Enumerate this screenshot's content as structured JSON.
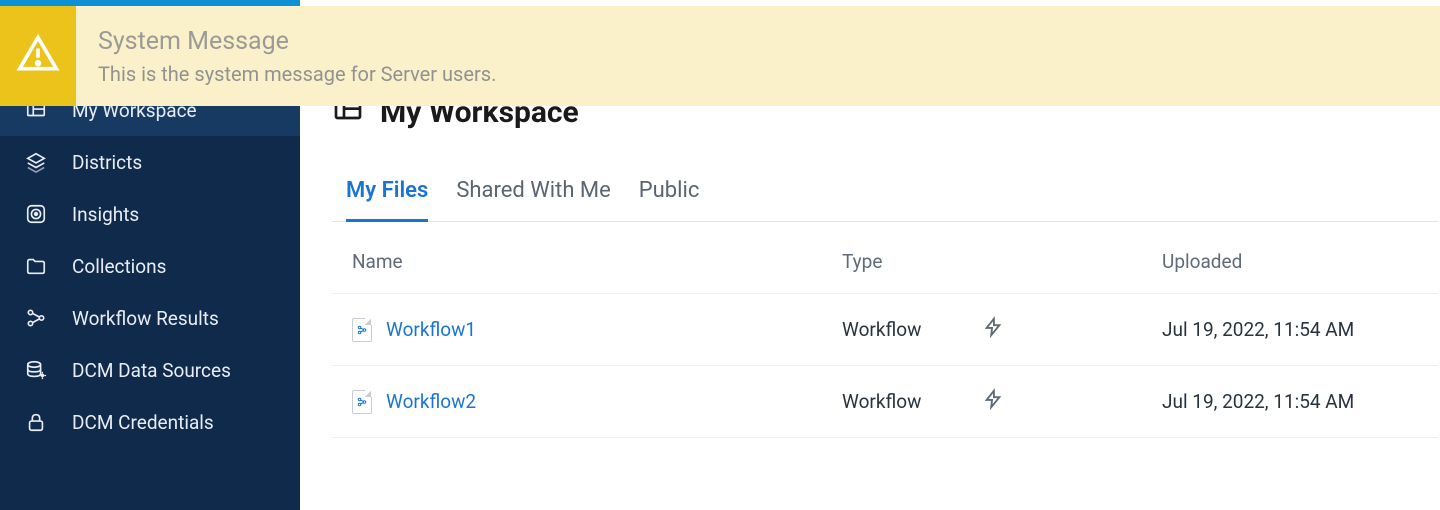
{
  "banner": {
    "title": "System Message",
    "message": "This is the system message for Server users."
  },
  "sidebar": {
    "items": [
      {
        "label": "My Workspace",
        "icon": "workspace"
      },
      {
        "label": "Districts",
        "icon": "layers"
      },
      {
        "label": "Insights",
        "icon": "target"
      },
      {
        "label": "Collections",
        "icon": "folder"
      },
      {
        "label": "Workflow Results",
        "icon": "nodes"
      },
      {
        "label": "DCM Data Sources",
        "icon": "database"
      },
      {
        "label": "DCM Credentials",
        "icon": "lock"
      }
    ]
  },
  "page": {
    "title": "My Workspace"
  },
  "tabs": [
    {
      "label": "My Files"
    },
    {
      "label": "Shared With Me"
    },
    {
      "label": "Public"
    }
  ],
  "table": {
    "headers": {
      "name": "Name",
      "type": "Type",
      "uploaded": "Uploaded"
    },
    "rows": [
      {
        "name": "Workflow1",
        "type": "Workflow",
        "uploaded": "Jul 19, 2022, 11:54 AM"
      },
      {
        "name": "Workflow2",
        "type": "Workflow",
        "uploaded": "Jul 19, 2022, 11:54 AM"
      }
    ]
  }
}
